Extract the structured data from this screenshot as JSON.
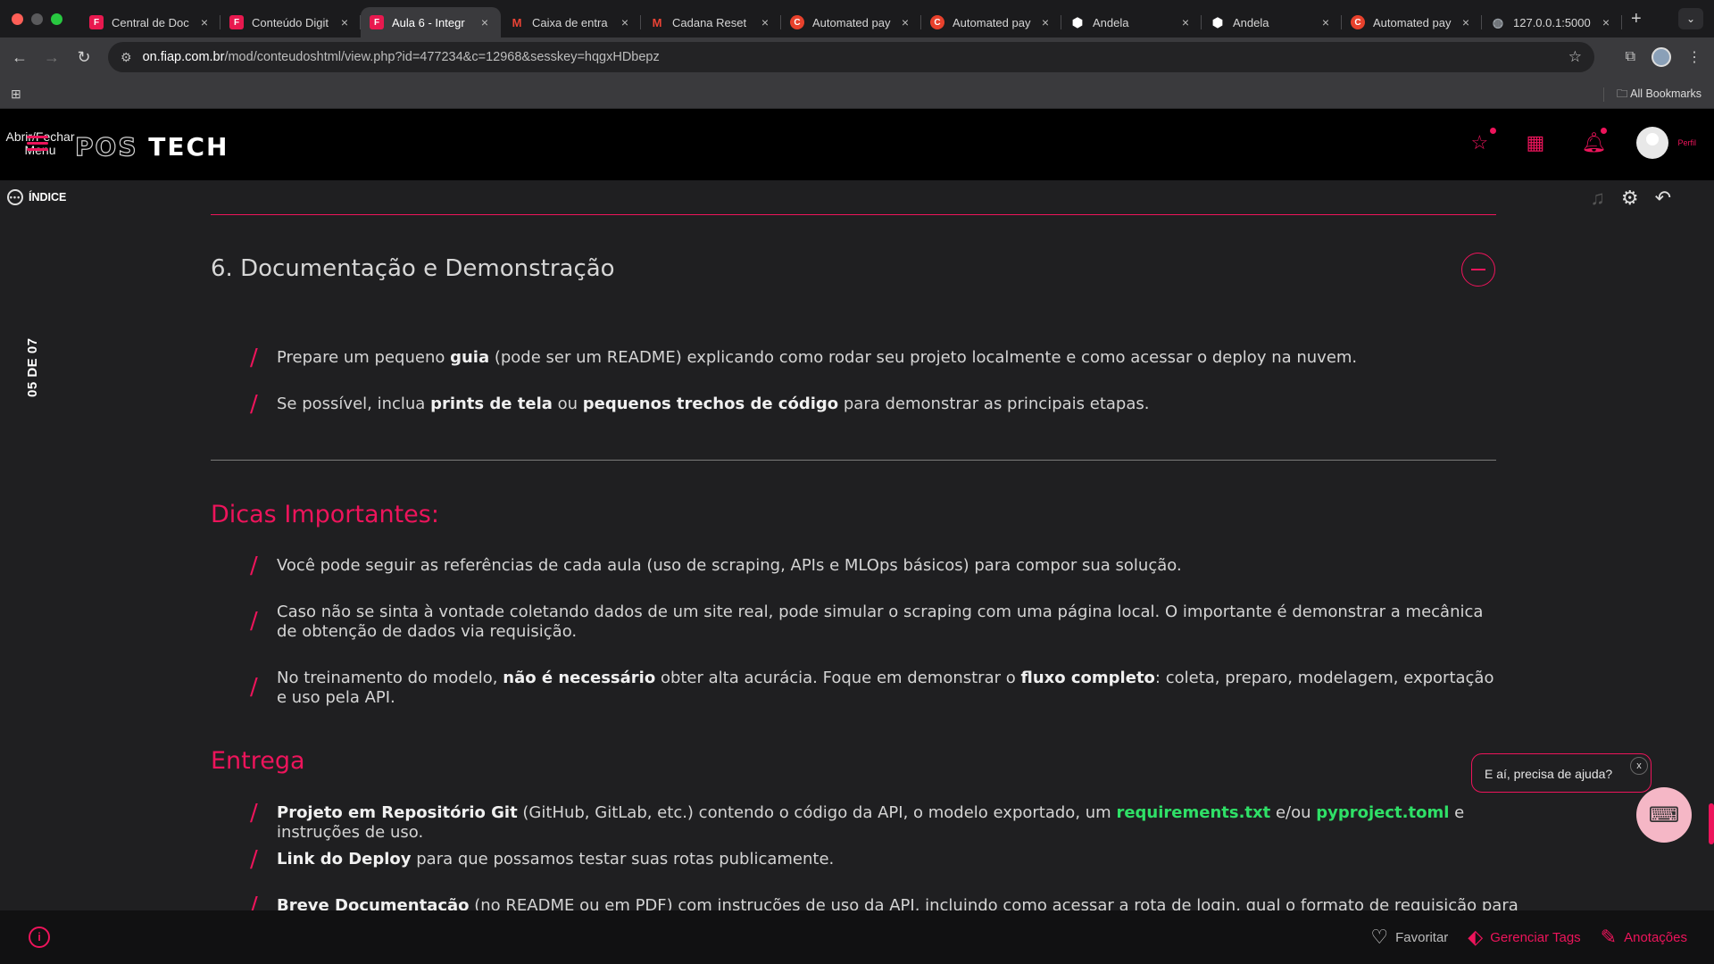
{
  "browser": {
    "tabs": [
      {
        "title": "Central de Doc",
        "favicon": "fiap-icon",
        "color": "#e8194f"
      },
      {
        "title": "Conteúdo Digit",
        "favicon": "fiap-icon",
        "color": "#e8194f"
      },
      {
        "title": "Aula 6 - Integr",
        "favicon": "fiap-icon",
        "color": "#e8194f",
        "active": true
      },
      {
        "title": "Caixa de entra",
        "favicon": "gmail-icon",
        "color": "#ea4335"
      },
      {
        "title": "Cadana Reset",
        "favicon": "gmail-icon",
        "color": "#ea4335"
      },
      {
        "title": "Automated pay",
        "favicon": "c-icon",
        "color": "#e8412c"
      },
      {
        "title": "Automated pay",
        "favicon": "c-icon",
        "color": "#e8412c"
      },
      {
        "title": "Andela",
        "favicon": "andela-icon",
        "color": "#ffffff"
      },
      {
        "title": "Andela",
        "favicon": "andela-icon",
        "color": "#ffffff"
      },
      {
        "title": "Automated pay",
        "favicon": "c-icon",
        "color": "#e8412c"
      },
      {
        "title": "127.0.0.1:5000",
        "favicon": "globe-icon",
        "color": "#9aa0a6"
      }
    ],
    "url_host": "on.fiap.com.br",
    "url_path": "/mod/conteudoshtml/view.php?id=477234&c=12968&sesskey=hqgxHDbepz",
    "all_bookmarks": "All Bookmarks"
  },
  "header": {
    "menu_toggle": "Abrir/Fechar Menu",
    "brand_pos": "POS",
    "brand_tech": "TECH",
    "profile_label": "Perfil",
    "accent": "#ed145b"
  },
  "index_bar": {
    "label": "ÍNDICE"
  },
  "page_indicator": "05 DE 07",
  "section6": {
    "title": "6. Documentação e Demonstração",
    "bullets": [
      [
        "Prepare um pequeno ",
        "guia",
        " (pode ser um README) explicando como rodar seu projeto localmente e como acessar o deploy na nuvem."
      ],
      [
        "Se possível, inclua ",
        "prints de tela",
        " ou ",
        "pequenos trechos de código",
        " para demonstrar as principais etapas."
      ]
    ]
  },
  "dicas": {
    "title": "Dicas Importantes:",
    "b1": "Você pode seguir as referências de cada aula (uso de scraping, APIs e MLOps básicos) para compor sua solução.",
    "b2": "Caso não se sinta à vontade coletando dados de um site real, pode simular o scraping com uma página local. O importante é demonstrar a mecânica de obtenção de dados via requisição.",
    "b3_pre": "No treinamento do modelo, ",
    "b3_bold1": "não é necessário",
    "b3_mid": " obter alta acurácia. Foque em demonstrar o ",
    "b3_bold2": "fluxo completo",
    "b3_post": ": coleta, preparo, modelagem, exportação e uso pela API."
  },
  "entrega": {
    "title": "Entrega",
    "b1_bold": "Projeto em Repositório Git",
    "b1_text": " (GitHub, GitLab, etc.) contendo o código da API, o modelo exportado, um ",
    "b1_green1": "requirements.txt",
    "b1_mid": " e/ou ",
    "b1_green2": "pyproject.toml",
    "b1_post": " e instruções de uso.",
    "b2_bold": "Link do Deploy",
    "b2_text": " para que possamos testar suas rotas publicamente.",
    "b3_bold": "Breve Documentação",
    "b3_text": " (no README ou em PDF) com instruções de uso da API, incluindo como acessar a rota de login, qual o formato de requisição para"
  },
  "help": {
    "bubble": "E aí, precisa de ajuda?",
    "close": "x"
  },
  "bottom": {
    "favoritar": "Favoritar",
    "tags": "Gerenciar Tags",
    "anotacoes": "Anotações"
  }
}
